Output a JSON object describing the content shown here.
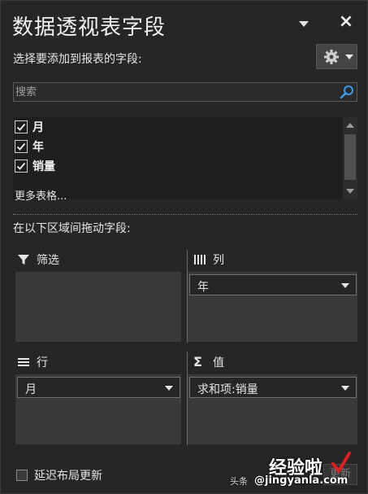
{
  "header": {
    "title": "数据透视表字段",
    "dropdown_icon": "chevron-down-icon",
    "close_label": "×"
  },
  "field_chooser": {
    "label": "选择要添加到报表的字段:",
    "settings_icon": "gear-icon",
    "search": {
      "placeholder": "搜索",
      "value": ""
    },
    "fields": [
      {
        "label": "月",
        "checked": true
      },
      {
        "label": "年",
        "checked": true
      },
      {
        "label": "销量",
        "checked": true
      }
    ],
    "more_tables": "更多表格..."
  },
  "areas": {
    "drag_label": "在以下区域间拖动字段:",
    "filters": {
      "title": "筛选",
      "icon": "filter-icon"
    },
    "columns": {
      "title": "列",
      "icon": "columns-icon",
      "item": "年"
    },
    "rows": {
      "title": "行",
      "icon": "rows-icon",
      "item": "月"
    },
    "values": {
      "title": "值",
      "icon": "sigma-icon",
      "item": "求和项:销量"
    }
  },
  "footer": {
    "defer_label": "延迟布局更新",
    "defer_checked": false,
    "update_label": "更新"
  },
  "watermark": {
    "small": "头条",
    "big": "经验啦",
    "url": "@jingyanla.com"
  },
  "colors": {
    "background": "#262626",
    "area_box": "#3a3a3a",
    "search_icon": "#3c9be8"
  }
}
